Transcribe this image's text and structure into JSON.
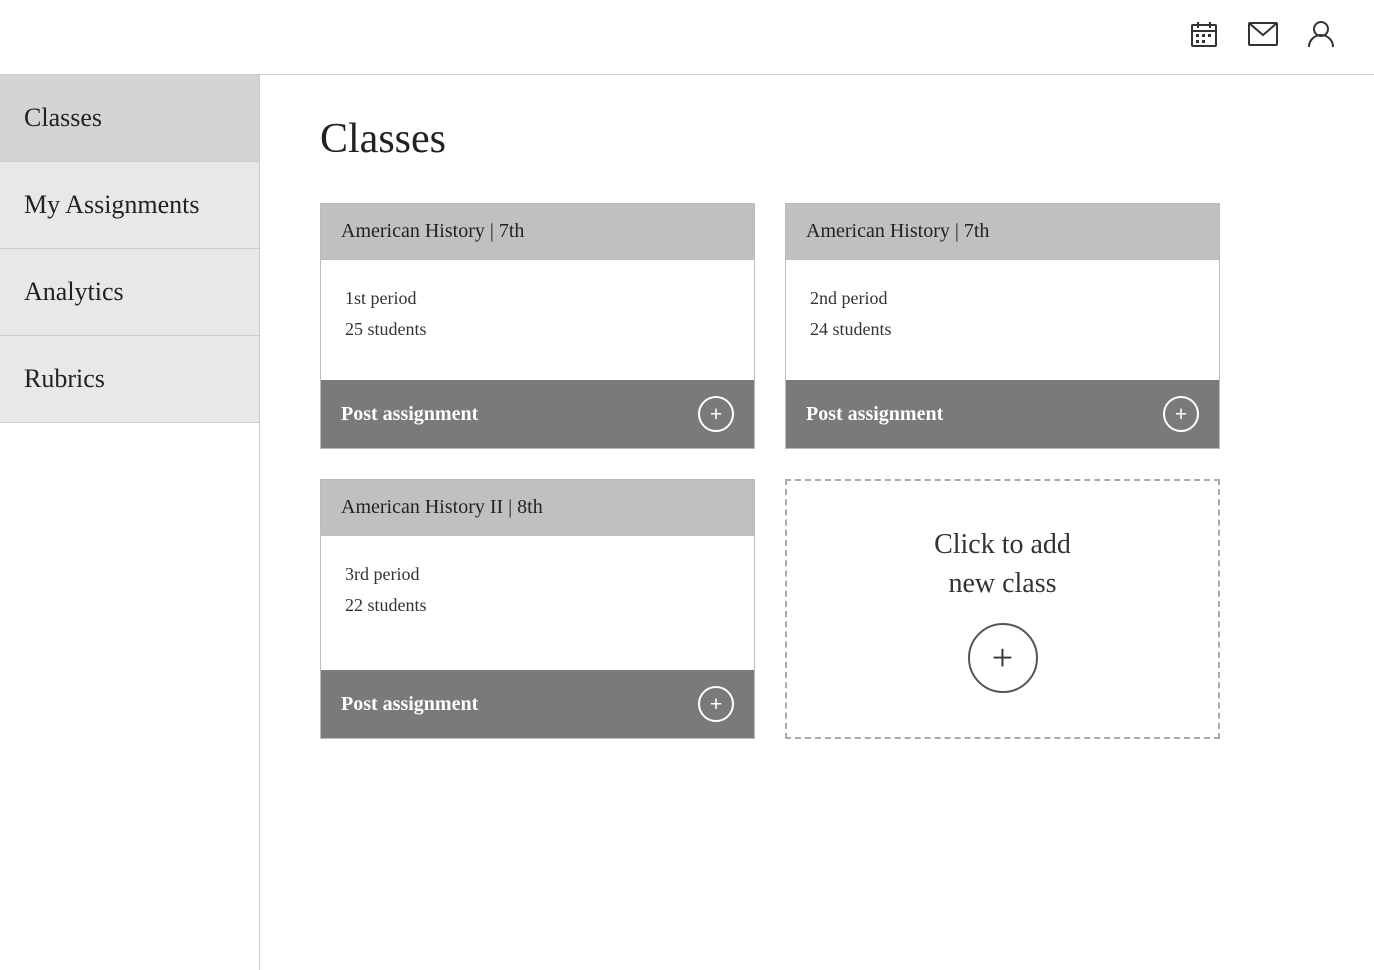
{
  "header": {
    "calendar_icon": "📅",
    "mail_icon": "✉",
    "user_icon": "👤"
  },
  "sidebar": {
    "items": [
      {
        "label": "Classes",
        "id": "classes"
      },
      {
        "label": "My Assignments",
        "id": "my-assignments"
      },
      {
        "label": "Analytics",
        "id": "analytics"
      },
      {
        "label": "Rubrics",
        "id": "rubrics"
      }
    ]
  },
  "main": {
    "page_title": "Classes",
    "cards": [
      {
        "title": "American History | 7th",
        "period": "1st period",
        "students": "25 students",
        "post_label": "Post assignment"
      },
      {
        "title": "American History | 7th",
        "period": "2nd period",
        "students": "24 students",
        "post_label": "Post assignment"
      },
      {
        "title": "American History II | 8th",
        "period": "3rd period",
        "students": "22 students",
        "post_label": "Post assignment"
      }
    ],
    "add_card_text": "Click to add\nnew class",
    "post_icon_symbol": "+",
    "add_icon_symbol": "+"
  }
}
